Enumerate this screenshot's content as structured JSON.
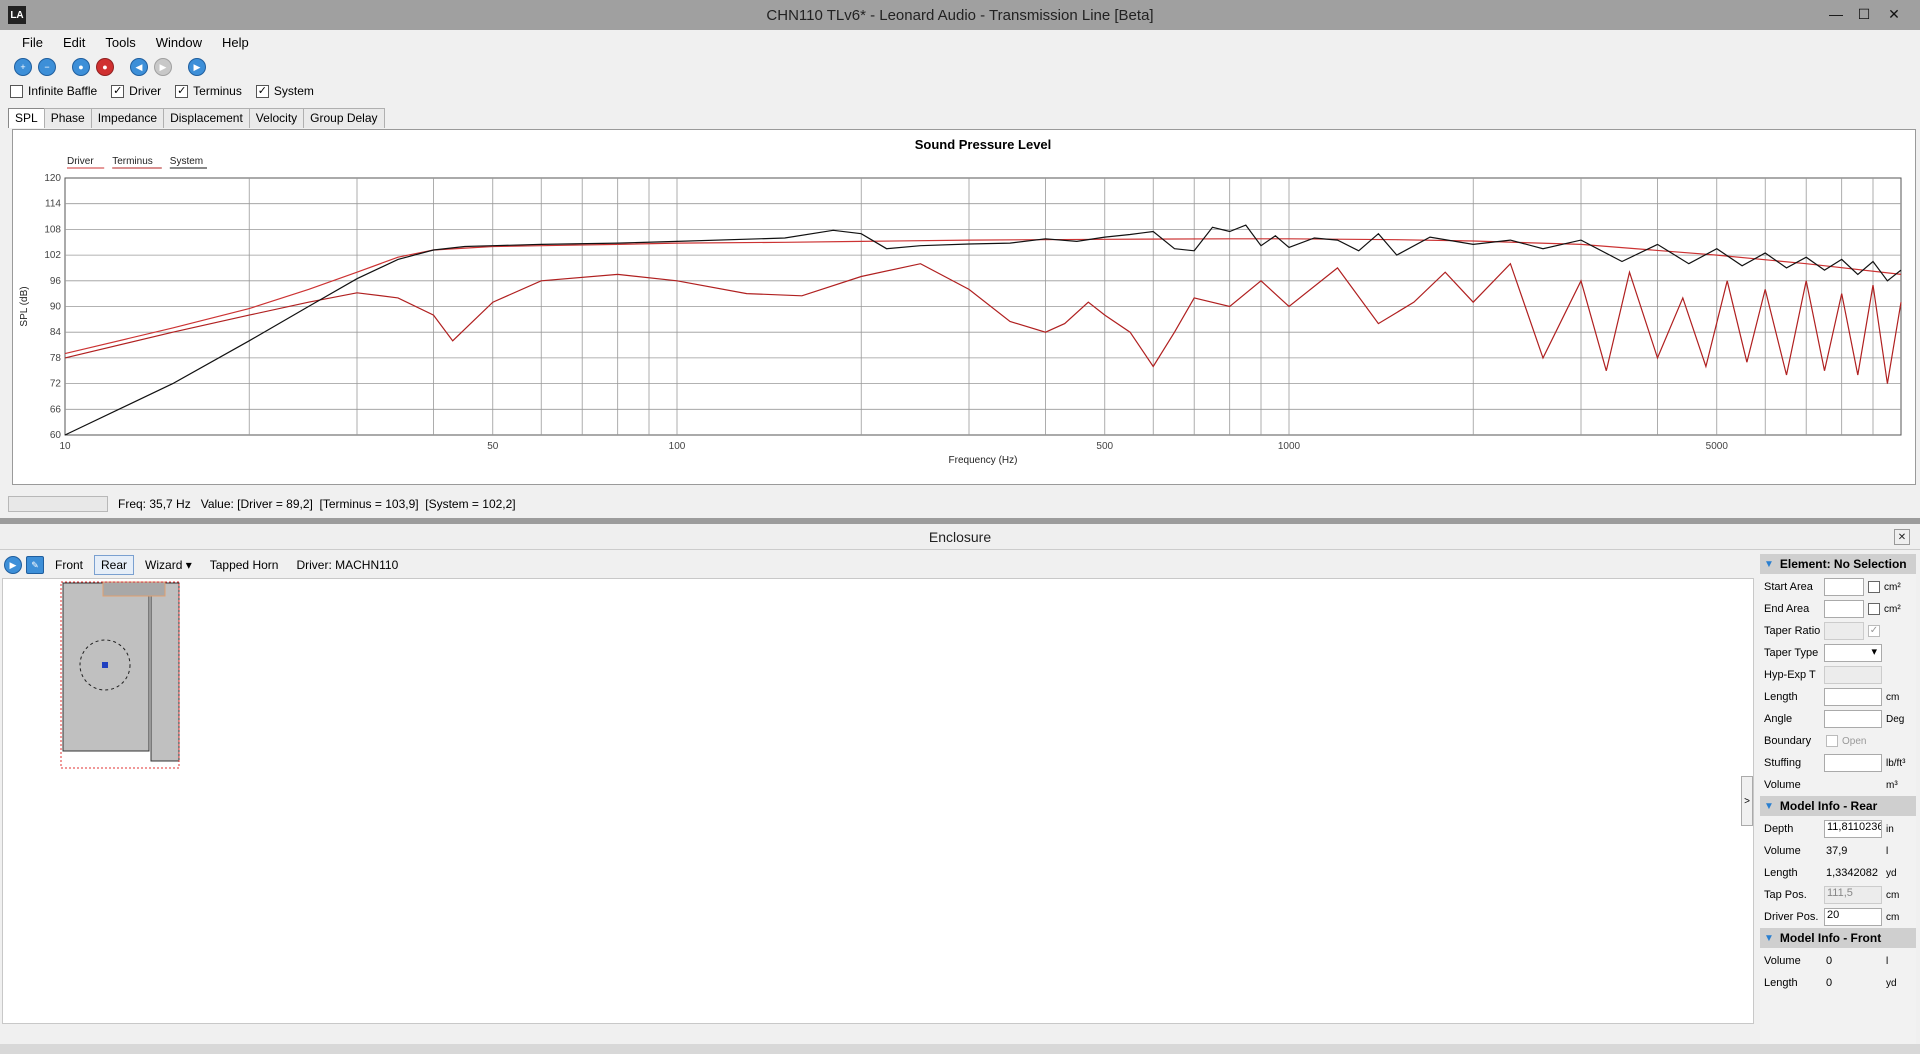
{
  "window": {
    "title": "CHN110 TLv6* - Leonard Audio - Transmission Line [Beta]",
    "logo": "LA",
    "minimize": "—",
    "maximize": "☐",
    "close": "✕"
  },
  "menu": [
    "File",
    "Edit",
    "Tools",
    "Window",
    "Help"
  ],
  "toolbar_icons": [
    "zoom-in-icon",
    "zoom-out-icon",
    "record-icon",
    "stop-icon",
    "back-icon",
    "forward-icon",
    "play-icon"
  ],
  "checks": [
    {
      "label": "Infinite Baffle",
      "checked": false
    },
    {
      "label": "Driver",
      "checked": true
    },
    {
      "label": "Terminus",
      "checked": true
    },
    {
      "label": "System",
      "checked": true
    }
  ],
  "tabs": [
    "SPL",
    "Phase",
    "Impedance",
    "Displacement",
    "Velocity",
    "Group Delay"
  ],
  "colors": {
    "driver": "#cc3333",
    "terminus": "#b02020",
    "system": "#111111",
    "accent": "#2a7fd0"
  },
  "chart_data": {
    "type": "line",
    "title": "Sound Pressure Level",
    "xlabel": "Frequency (Hz)",
    "ylabel": "SPL (dB)",
    "xscale": "log",
    "xlim": [
      10,
      10000
    ],
    "ylim": [
      60,
      120
    ],
    "yticks": [
      60,
      66,
      72,
      78,
      84,
      90,
      96,
      102,
      108,
      114,
      120
    ],
    "xtick_labels": [
      {
        "value": 10,
        "label": "10"
      },
      {
        "value": 50,
        "label": "50"
      },
      {
        "value": 100,
        "label": "100"
      },
      {
        "value": 500,
        "label": "500"
      },
      {
        "value": 1000,
        "label": "1000"
      },
      {
        "value": 5000,
        "label": "5000"
      }
    ],
    "grid": true,
    "legend": "top-left",
    "series": [
      {
        "name": "Driver",
        "color": "#cc3333",
        "x": [
          10,
          15,
          20,
          25,
          30,
          35,
          40,
          50,
          60,
          80,
          100,
          150,
          200,
          300,
          500,
          800,
          1000,
          1500,
          2000,
          3000,
          5000,
          7000,
          10000
        ],
        "y": [
          79,
          85,
          89.5,
          94,
          98,
          101.5,
          103.2,
          104,
          104.2,
          104.5,
          104.8,
          105,
          105.2,
          105.5,
          105.7,
          105.8,
          105.8,
          105.6,
          105.3,
          104.5,
          102,
          100,
          97.5
        ]
      },
      {
        "name": "Terminus",
        "color": "#b02020",
        "x": [
          10,
          15,
          20,
          25,
          30,
          35,
          40,
          43,
          46,
          50,
          60,
          80,
          100,
          130,
          160,
          200,
          250,
          300,
          350,
          400,
          430,
          470,
          500,
          550,
          600,
          650,
          700,
          800,
          900,
          1000,
          1200,
          1400,
          1600,
          1800,
          2000,
          2300,
          2600,
          3000,
          3300,
          3600,
          4000,
          4400,
          4800,
          5200,
          5600,
          6000,
          6500,
          7000,
          7500,
          8000,
          8500,
          9000,
          9500,
          10000
        ],
        "y": [
          78,
          84,
          88,
          91,
          93.2,
          92,
          88,
          82,
          86,
          91,
          96,
          97.5,
          96,
          93,
          92.5,
          97,
          100,
          94,
          86.5,
          84,
          86,
          91,
          88,
          84,
          76,
          84,
          92,
          90,
          96,
          90,
          99,
          86,
          91,
          98,
          91,
          100,
          78,
          96,
          75,
          98,
          78,
          92,
          76,
          96,
          77,
          94,
          74,
          96,
          75,
          93,
          74,
          95,
          72,
          91
        ]
      },
      {
        "name": "System",
        "color": "#111111",
        "x": [
          10,
          15,
          20,
          25,
          30,
          35,
          40,
          45,
          50,
          60,
          80,
          100,
          150,
          180,
          200,
          220,
          250,
          300,
          350,
          400,
          450,
          500,
          550,
          600,
          650,
          700,
          750,
          800,
          850,
          900,
          950,
          1000,
          1100,
          1200,
          1300,
          1400,
          1500,
          1700,
          2000,
          2300,
          2600,
          3000,
          3500,
          4000,
          4500,
          5000,
          5500,
          6000,
          6500,
          7000,
          7500,
          8000,
          8500,
          9000,
          9500,
          10000
        ],
        "y": [
          60,
          72,
          82,
          90,
          96.5,
          101,
          103.2,
          104,
          104.2,
          104.5,
          104.8,
          105.2,
          106,
          107.8,
          107,
          103.5,
          104.2,
          104.6,
          104.8,
          105.8,
          105.2,
          106.2,
          106.8,
          107.5,
          103.5,
          103,
          108.5,
          107.5,
          109,
          104.2,
          106.5,
          103.8,
          106,
          105.5,
          103,
          107,
          102,
          106.2,
          104.5,
          105.5,
          103.5,
          105.5,
          100.5,
          104.5,
          100,
          103.5,
          99.5,
          102.5,
          99,
          101.5,
          98.5,
          101,
          97.5,
          100.5,
          96,
          98.5
        ]
      }
    ]
  },
  "status": {
    "text": "Freq: 35,7 Hz   Value: [Driver = 89,2]  [Terminus = 103,9]  [System = 102,2]"
  },
  "enclosure": {
    "title": "Enclosure",
    "close": "✕",
    "toolbar": [
      "Front",
      "Rear",
      "Wizard ▾",
      "Tapped Horn",
      "Driver: MACHN110"
    ],
    "toggle": ">"
  },
  "props": {
    "element_title": "Element: No Selection",
    "element_rows": [
      {
        "label": "Start Area",
        "unit": "cm²"
      },
      {
        "label": "End Area",
        "unit": "cm²"
      },
      {
        "label": "Taper Ratio",
        "unit": ""
      },
      {
        "label": "Taper Type",
        "unit": ""
      },
      {
        "label": "Hyp-Exp T",
        "unit": ""
      },
      {
        "label": "Length",
        "unit": "cm"
      },
      {
        "label": "Angle",
        "unit": "Deg"
      },
      {
        "label": "Boundary",
        "unit": "Open"
      },
      {
        "label": "Stuffing",
        "unit": "lb/ft³"
      },
      {
        "label": "Volume",
        "unit": "m³"
      }
    ],
    "rear_title": "Model Info - Rear",
    "rear_rows": [
      {
        "label": "Depth",
        "value": "11,8110236",
        "unit": "in"
      },
      {
        "label": "Volume",
        "value": "37,9",
        "unit": "l"
      },
      {
        "label": "Length",
        "value": "1,3342082",
        "unit": "yd"
      },
      {
        "label": "Tap Pos.",
        "value": "111,5",
        "unit": "cm"
      },
      {
        "label": "Driver Pos.",
        "value": "20",
        "unit": "cm"
      }
    ],
    "front_title": "Model Info - Front",
    "front_rows": [
      {
        "label": "Volume",
        "value": "0",
        "unit": "l"
      },
      {
        "label": "Length",
        "value": "0",
        "unit": "yd"
      }
    ]
  }
}
